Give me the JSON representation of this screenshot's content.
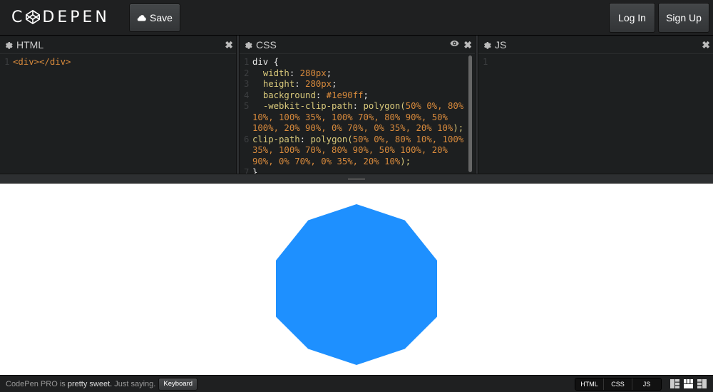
{
  "header": {
    "logo_text": "CODEPEN",
    "save_label": "Save",
    "login_label": "Log In",
    "signup_label": "Sign Up"
  },
  "editors": {
    "html": {
      "title": "HTML",
      "lines": [
        {
          "n": "1",
          "text": "<div></div>"
        }
      ]
    },
    "css": {
      "title": "CSS",
      "line_numbers": [
        "1",
        "2",
        "3",
        "4",
        "5",
        "",
        "",
        "6",
        "",
        "",
        "7"
      ],
      "code": {
        "l1_selector": "div {",
        "l2_prop": "width",
        "l2_val": "280px",
        "l3_prop": "height",
        "l3_val": "280px",
        "l4_prop": "background",
        "l4_val": "#1e90ff",
        "l5_prop": "-webkit-clip-path",
        "l5_fn": "polygon(",
        "l5_args_a": "50% 0%, 80%",
        "l5_args_b": "10%, 100% 35%, 100% 70%, 80% 90%, 50%",
        "l5_args_c": "100%, 20% 90%, 0% 70%, 0% 35%, 20% 10%",
        "l5_end": ");",
        "l6_prop": "clip-path",
        "l6_fn": "polygon(",
        "l6_args_a": "50% 0%, 80% 10%, 100%",
        "l6_args_b": "35%, 100% 70%, 80% 90%, 50% 100%, 20%",
        "l6_args_c": "90%, 0% 70%, 0% 35%, 20% 10%",
        "l6_end": ");",
        "l7": "}"
      }
    },
    "js": {
      "title": "JS",
      "lines": [
        {
          "n": "1",
          "text": ""
        }
      ]
    }
  },
  "preview": {
    "shape_color": "#1e90ff"
  },
  "footer": {
    "pro_text": "CodePen PRO",
    "is_text": "is",
    "sweet_text": "pretty sweet.",
    "saying_text": "Just saying.",
    "keyboard_label": "Keyboard",
    "toggle_html": "HTML",
    "toggle_css": "CSS",
    "toggle_js": "JS"
  },
  "colors": {
    "accent": "#1e90ff",
    "header_bg": "#1f2021"
  },
  "icons": [
    "codepen-logo-icon",
    "cloud-icon",
    "gear-icon",
    "close-icon",
    "eye-icon",
    "layout-left-icon",
    "layout-top-icon",
    "layout-right-icon"
  ]
}
